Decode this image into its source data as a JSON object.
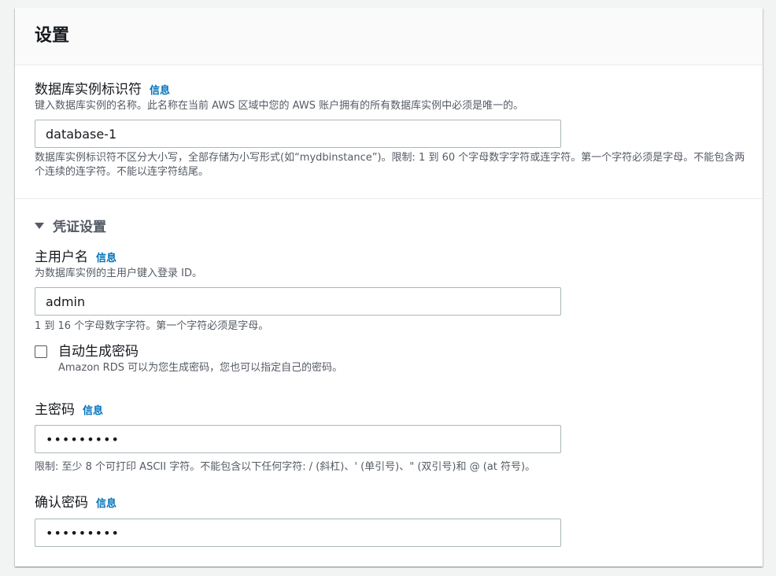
{
  "panel": {
    "title": "设置"
  },
  "identifier": {
    "label": "数据库实例标识符",
    "info": "信息",
    "description": "键入数据库实例的名称。此名称在当前 AWS 区域中您的 AWS 账户拥有的所有数据库实例中必须是唯一的。",
    "value": "database-1",
    "constraint": "数据库实例标识符不区分大小写，全部存储为小写形式(如“mydbinstance”)。限制: 1 到 60 个字母数字字符或连字符。第一个字符必须是字母。不能包含两个连续的连字符。不能以连字符结尾。"
  },
  "credentials": {
    "label": "凭证设置",
    "expanded": true
  },
  "master_username": {
    "label": "主用户名",
    "info": "信息",
    "description": "为数据库实例的主用户键入登录 ID。",
    "value": "admin",
    "constraint": "1 到 16 个字母数字字符。第一个字符必须是字母。"
  },
  "auto_password": {
    "label": "自动生成密码",
    "description": "Amazon RDS 可以为您生成密码，您也可以指定自己的密码。",
    "checked": false
  },
  "master_password": {
    "label": "主密码",
    "info": "信息",
    "value": "•••••••••",
    "constraint": "限制: 至少 8 个可打印 ASCII 字符。不能包含以下任何字符: / (斜杠)、' (单引号)、\" (双引号)和 @ (at 符号)。"
  },
  "confirm_password": {
    "label": "确认密码",
    "info": "信息",
    "value": "•••••••••"
  },
  "colors": {
    "link": "#0073bb",
    "text": "#16191f",
    "secondary": "#545b64",
    "border": "#aab7b8"
  }
}
